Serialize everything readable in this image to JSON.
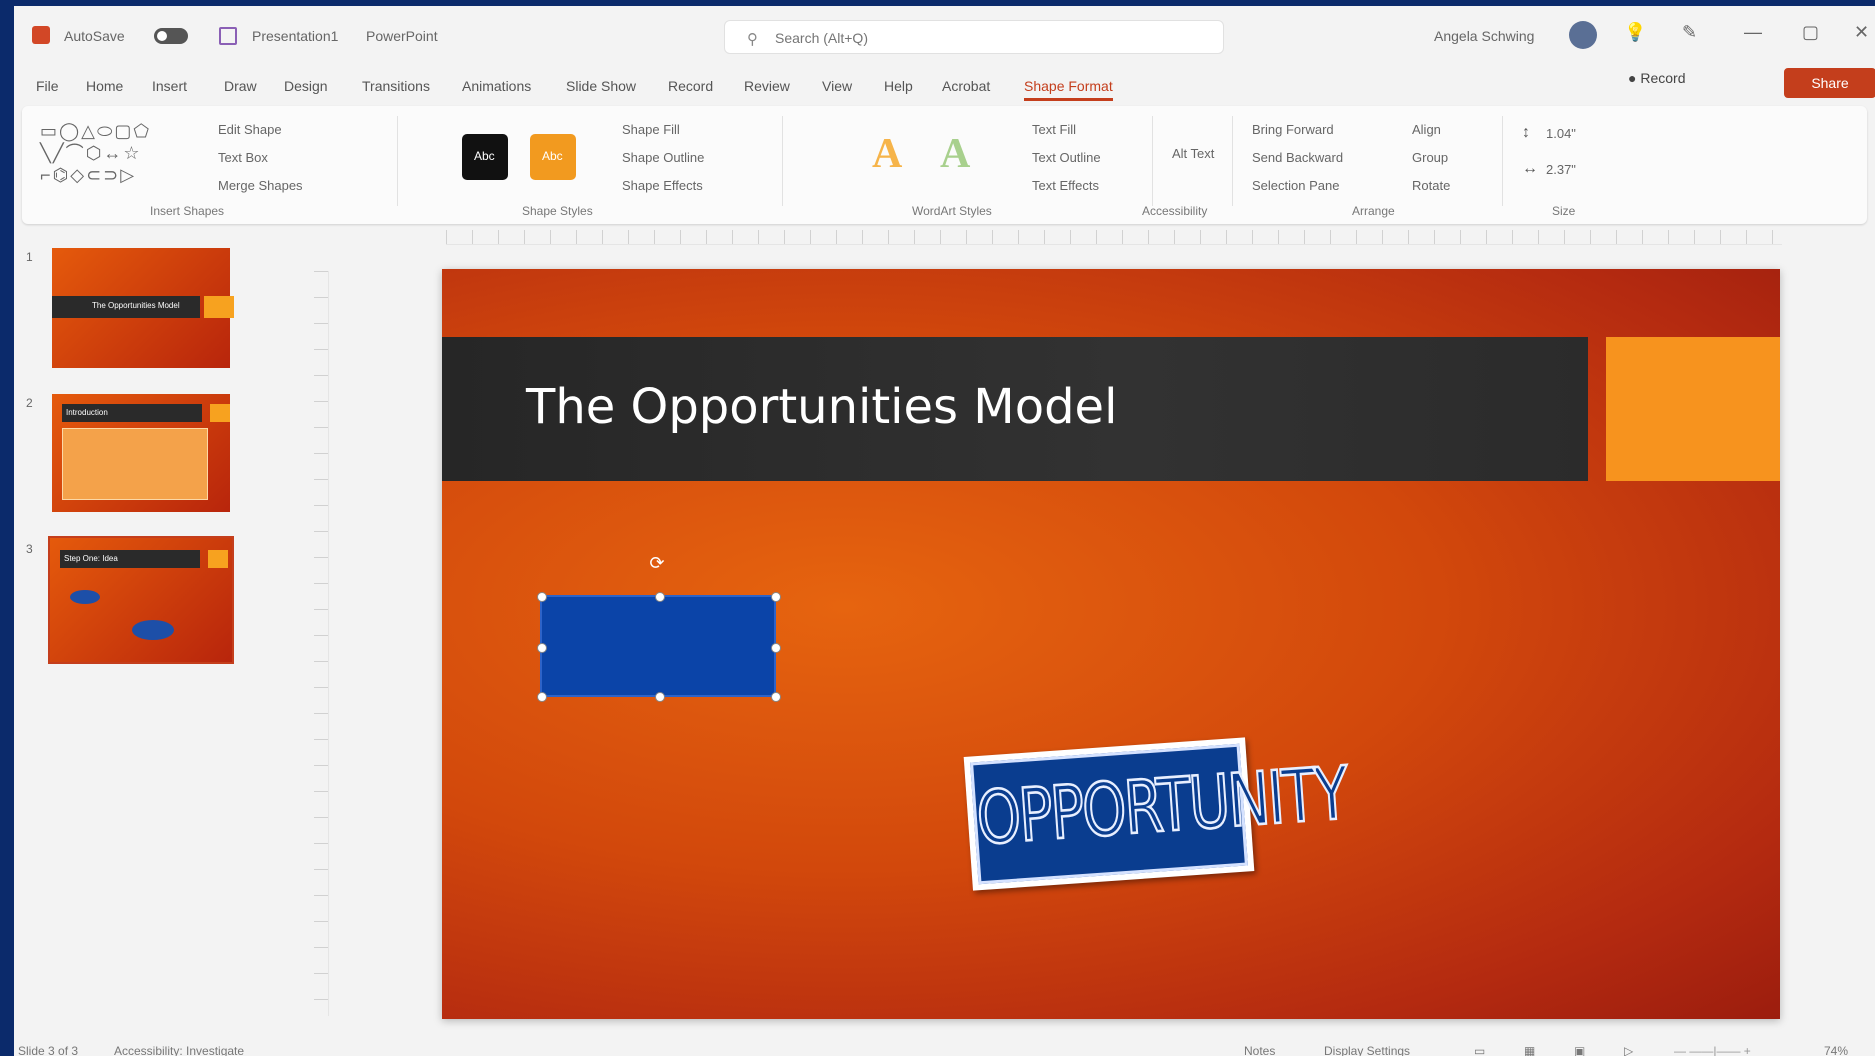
{
  "window": {
    "autosave_label": "AutoSave",
    "doc_name": "Presentation1",
    "app_name": "PowerPoint",
    "search_placeholder": "Search (Alt+Q)",
    "user_name": "Angela Schwing"
  },
  "tabs": [
    "File",
    "Home",
    "Insert",
    "Draw",
    "Design",
    "Transitions",
    "Animations",
    "Slide Show",
    "Record",
    "Review",
    "View",
    "Help",
    "Acrobat",
    "Shape Format"
  ],
  "active_tab": "Shape Format",
  "toolbar": {
    "record_label": "Record",
    "share_label": "Share"
  },
  "ribbon": {
    "groups": {
      "insert_shapes": "Insert Shapes",
      "shape_styles": "Shape Styles",
      "wordart_styles": "WordArt Styles",
      "accessibility": "Accessibility",
      "arrange": "Arrange",
      "size": "Size"
    },
    "edit_shape": "Edit Shape",
    "text_box": "Text Box",
    "merge_shapes": "Merge Shapes",
    "swatch_label": "Abc",
    "shape_fill": "Shape Fill",
    "shape_outline": "Shape Outline",
    "shape_effects": "Shape Effects",
    "text_fill": "Text Fill",
    "text_outline": "Text Outline",
    "text_effects": "Text Effects",
    "alt_text": "Alt Text",
    "bring_forward": "Bring Forward",
    "send_backward": "Send Backward",
    "selection_pane": "Selection Pane",
    "align": "Align",
    "group": "Group",
    "rotate": "Rotate",
    "height": "1.04\"",
    "width": "2.37\""
  },
  "thumbnails": [
    {
      "num": "1",
      "title": "The Opportunities Model"
    },
    {
      "num": "2",
      "title": "Introduction"
    },
    {
      "num": "3",
      "title": "Step One: Idea"
    }
  ],
  "slide": {
    "title": "The Opportunities Model",
    "image_text": "OPPORTUNITY"
  },
  "status": {
    "slide_counter": "Slide 3 of 3",
    "accessibility": "Accessibility: Investigate",
    "notes": "Notes",
    "display_settings": "Display Settings",
    "zoom": "74%"
  },
  "colors": {
    "accent": "#c43e1c",
    "slide_orange": "#e55a0c",
    "slide_square": "#f7931e",
    "shape_blue": "#0b44a8",
    "title_band": "#2b2b2b"
  }
}
